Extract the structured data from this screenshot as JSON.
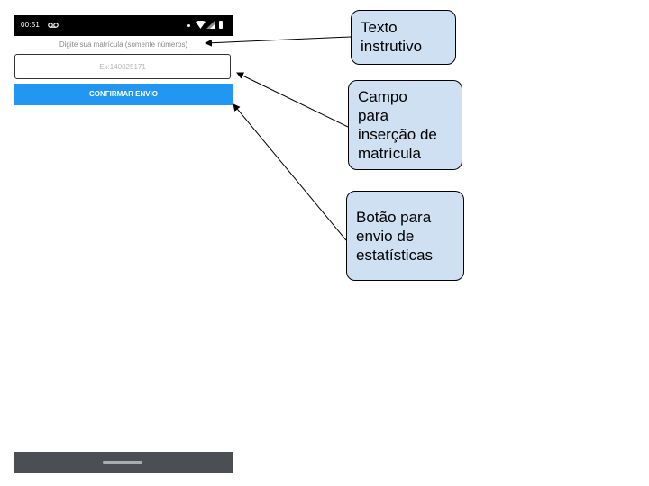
{
  "status_bar": {
    "time": "00:51",
    "icons": [
      "voicemail-icon",
      "dot-icon",
      "wifi-icon",
      "signal-icon",
      "battery-icon"
    ]
  },
  "form": {
    "instruction": "Digite sua matrícula (somente números)",
    "input_placeholder": "Ex:140025171",
    "input_value": "",
    "confirm_label": "CONFIRMAR ENVIO"
  },
  "callouts": {
    "instruction_text": "Texto\ninstrutivo",
    "input_field": "Campo\npara\ninserção de\nmatrícula",
    "send_button": "Botão para\nenvio de\nestatísticas"
  },
  "colors": {
    "status_bar": "#000000",
    "button": "#2196f3",
    "button_text": "#ffffff",
    "nav_bar": "#4b4f54",
    "callout_fill": "#cfe0f3"
  }
}
